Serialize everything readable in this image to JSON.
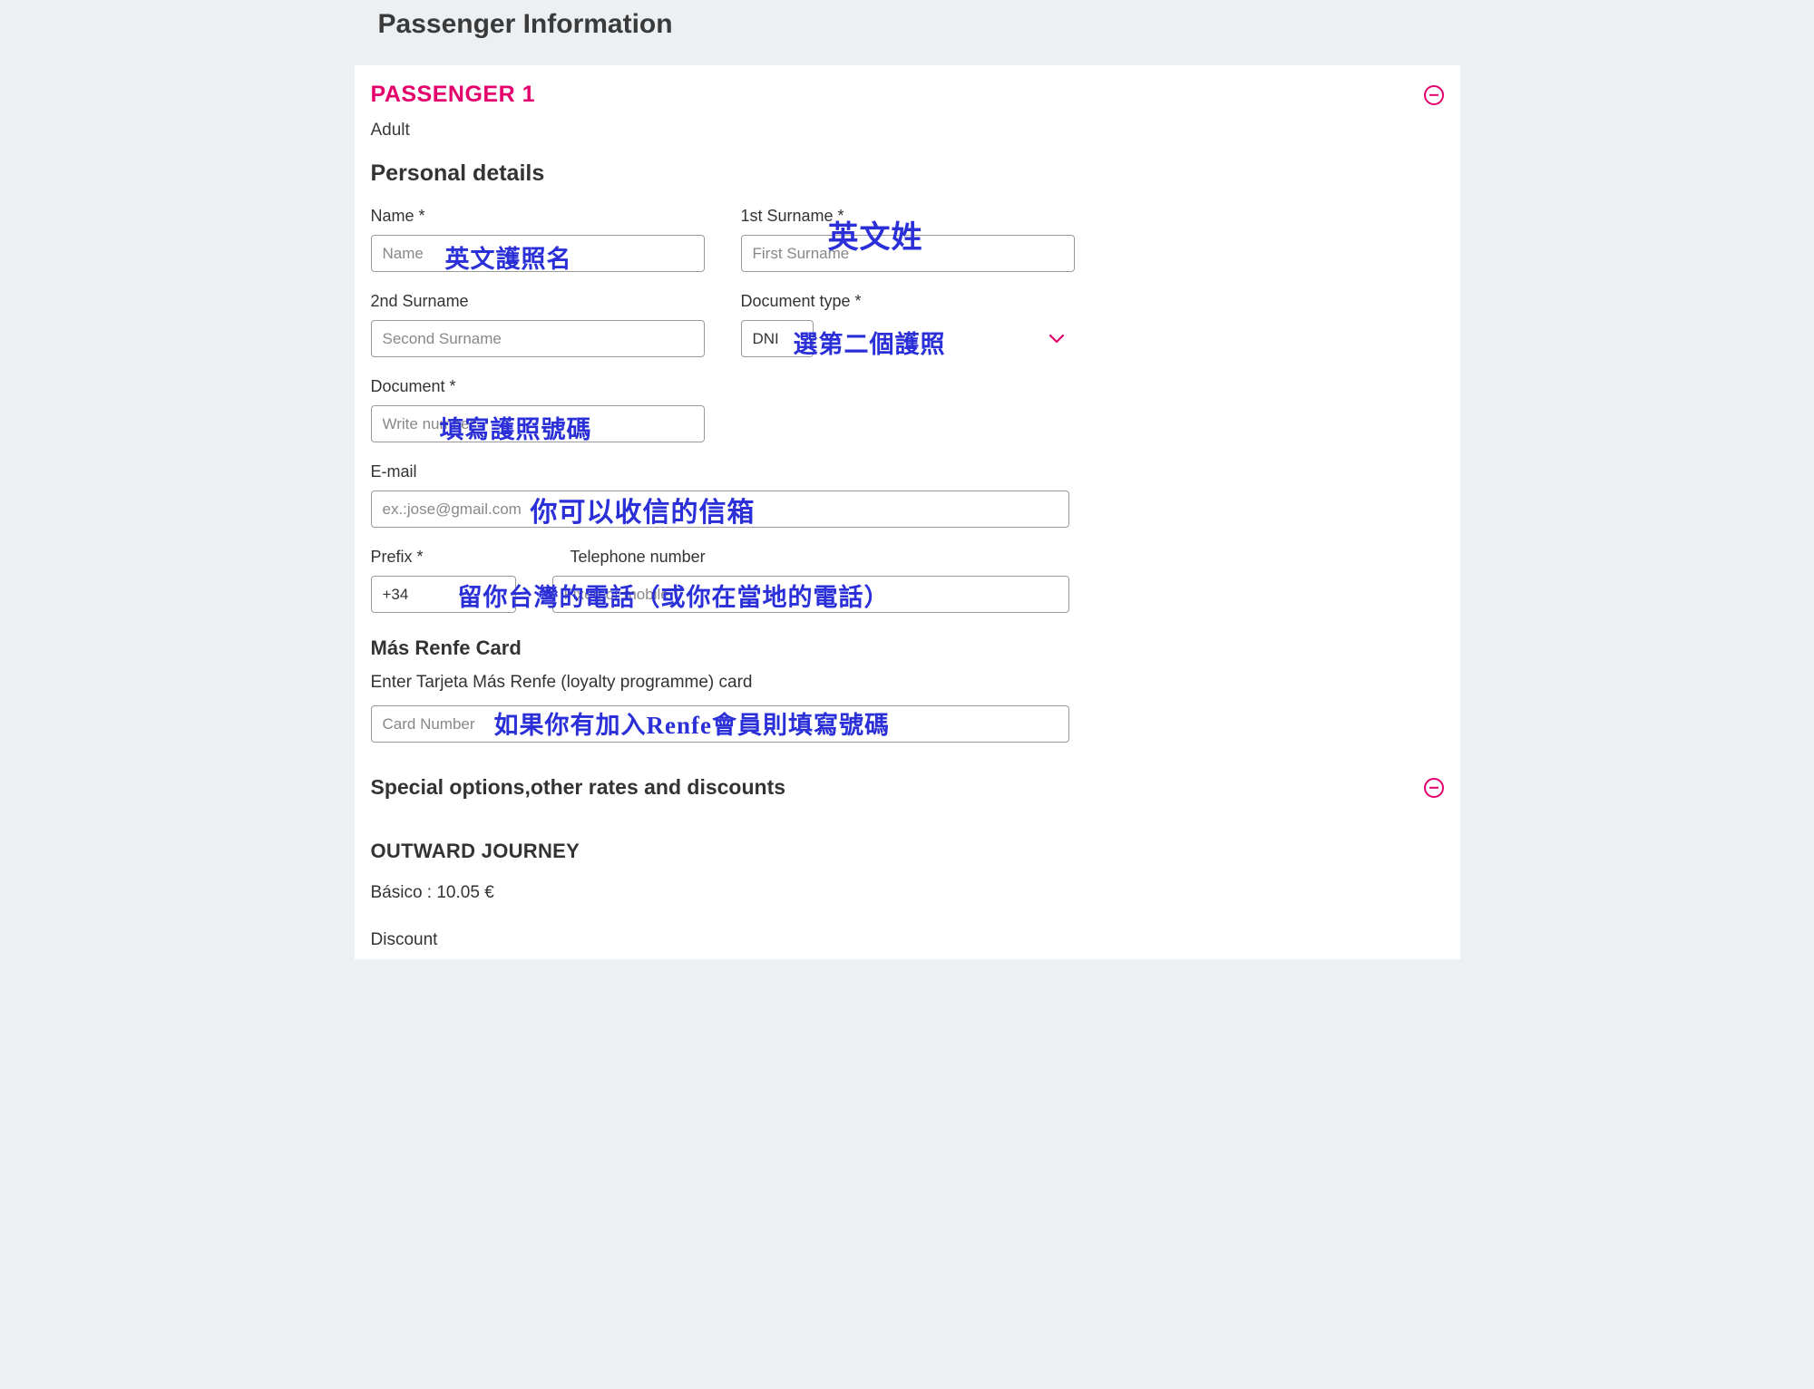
{
  "header": {
    "title": "Passenger Information"
  },
  "passenger": {
    "title": "PASSENGER 1",
    "type": "Adult"
  },
  "sections": {
    "personal_details": "Personal details",
    "mas_renfe": "Más Renfe Card",
    "special": "Special options,other rates and discounts",
    "outward": "OUTWARD JOURNEY",
    "discount": "Discount"
  },
  "fields": {
    "name": {
      "label": "Name *",
      "placeholder": "Name"
    },
    "surname1": {
      "label": "1st Surname *",
      "placeholder": "First Surname"
    },
    "surname2": {
      "label": "2nd Surname",
      "placeholder": "Second Surname"
    },
    "doctype": {
      "label": "Document type *",
      "value": "DNI"
    },
    "document": {
      "label": "Document *",
      "placeholder": "Write number"
    },
    "email": {
      "label": "E-mail",
      "placeholder": "ex.:jose@gmail.com"
    },
    "prefix": {
      "label": "Prefix *",
      "value": "+34"
    },
    "phone": {
      "label": "Telephone number",
      "placeholder": "Fixed or mobile"
    },
    "loyalty_desc": "Enter Tarjeta Más Renfe (loyalty programme) card",
    "loyalty": {
      "placeholder": "Card Number"
    }
  },
  "fare": {
    "line": "Básico : 10.05 €"
  },
  "annotations": {
    "name": "英文護照名",
    "surname": "英文姓",
    "doctype": "選第二個護照",
    "document": "填寫護照號碼",
    "email": "你可以收信的信箱",
    "phone": "留你台灣的電話（或你在當地的電話）",
    "loyalty": "如果你有加入Renfe會員則填寫號碼"
  }
}
